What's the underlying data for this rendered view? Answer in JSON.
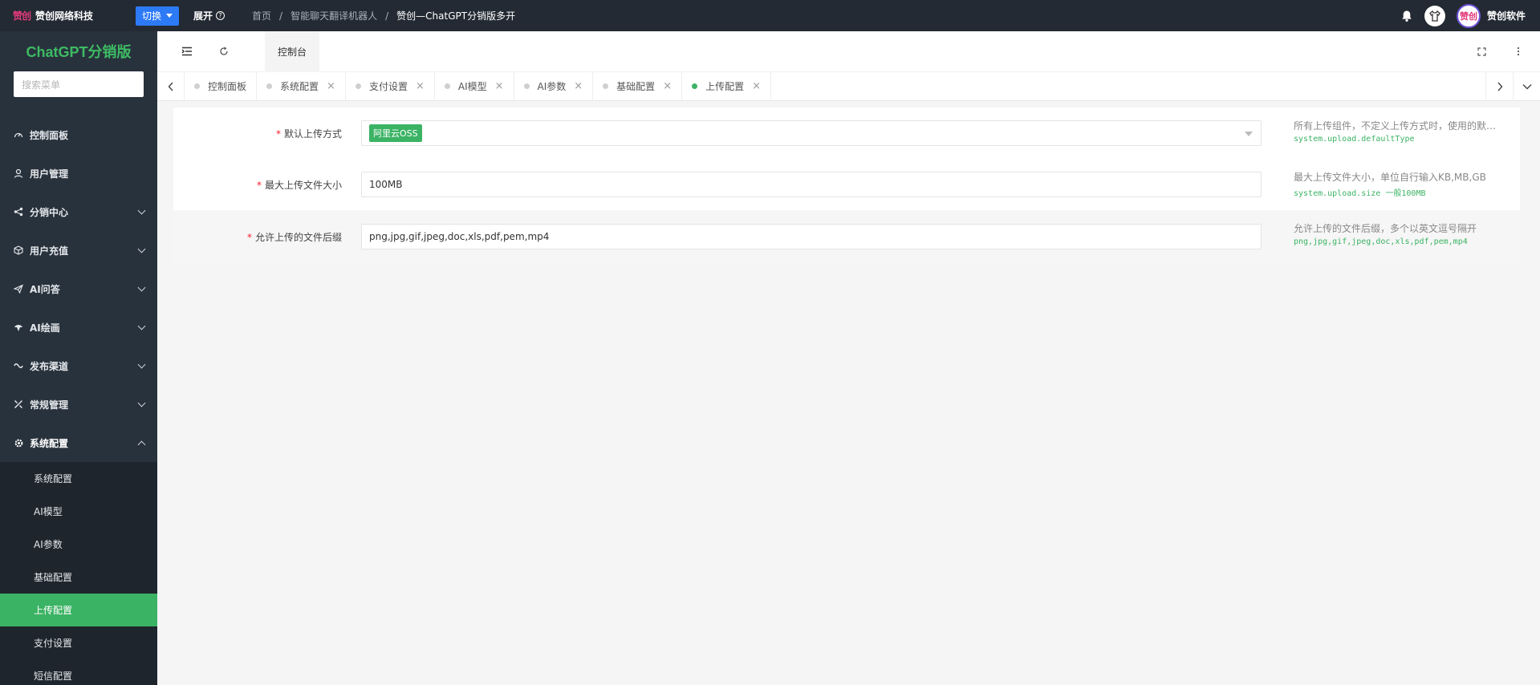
{
  "topbar": {
    "logo_text": "赞创",
    "company": "赞创网络科技",
    "switch_label": "切换",
    "expand_label": "展开",
    "breadcrumb": [
      "首页",
      "智能聊天翻译机器人",
      "赞创—ChatGPT分销版多开"
    ],
    "user_name": "赞创软件",
    "avatar_text": "赞创"
  },
  "sidebar": {
    "title": "ChatGPT分销版",
    "search_placeholder": "搜索菜单",
    "menu": [
      {
        "label": "控制面板",
        "icon": "dashboard-icon"
      },
      {
        "label": "用户管理",
        "icon": "user-icon"
      },
      {
        "label": "分销中心",
        "icon": "share-icon"
      },
      {
        "label": "用户充值",
        "icon": "box-icon"
      },
      {
        "label": "AI问答",
        "icon": "send-icon"
      },
      {
        "label": "AI绘画",
        "icon": "brush-icon"
      },
      {
        "label": "发布渠道",
        "icon": "link-icon"
      },
      {
        "label": "常规管理",
        "icon": "tools-icon"
      },
      {
        "label": "系统配置",
        "icon": "gear-icon"
      }
    ],
    "submenu": [
      "系统配置",
      "AI模型",
      "AI参数",
      "基础配置",
      "上传配置",
      "支付设置",
      "短信配置"
    ]
  },
  "header": {
    "console_tab": "控制台"
  },
  "tabs": [
    {
      "label": "控制面板",
      "closable": false,
      "active": false
    },
    {
      "label": "系统配置",
      "closable": true,
      "active": false
    },
    {
      "label": "支付设置",
      "closable": true,
      "active": false
    },
    {
      "label": "AI模型",
      "closable": true,
      "active": false
    },
    {
      "label": "AI参数",
      "closable": true,
      "active": false
    },
    {
      "label": "基础配置",
      "closable": true,
      "active": false
    },
    {
      "label": "上传配置",
      "closable": true,
      "active": true
    }
  ],
  "form": {
    "rows": [
      {
        "label": "默认上传方式",
        "value": "阿里云OSS",
        "help": "所有上传组件，不定义上传方式时，使用的默…",
        "code": "system.upload.defaultType"
      },
      {
        "label": "最大上传文件大小",
        "value": "100MB",
        "help": "最大上传文件大小，单位自行输入KB,MB,GB",
        "code": "system.upload.size 一般100MB"
      },
      {
        "label": "允许上传的文件后缀",
        "value": "png,jpg,gif,jpeg,doc,xls,pdf,pem,mp4",
        "help": "允许上传的文件后缀，多个以英文逗号隔开",
        "code": "png,jpg,gif,jpeg,doc,xls,pdf,pem,mp4"
      }
    ]
  },
  "colors": {
    "accent": "#3bb364",
    "topbar": "#232a33",
    "sidebar": "#28323d",
    "switch": "#2d7af7"
  }
}
